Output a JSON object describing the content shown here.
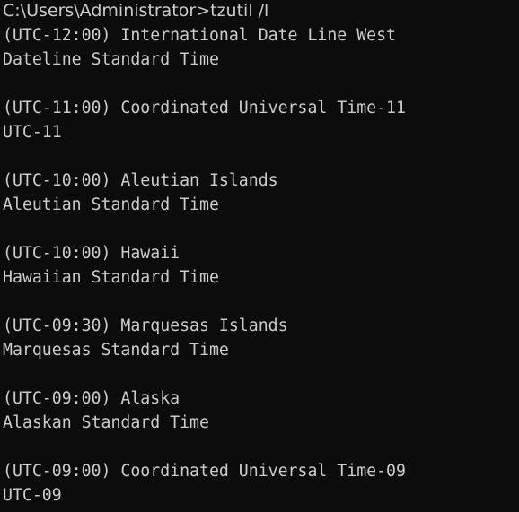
{
  "console": {
    "prompt": "C:\\Users\\Administrator>",
    "command": "tzutil /l",
    "output_lines": [
      "(UTC-12:00) International Date Line West",
      "Dateline Standard Time",
      "",
      "(UTC-11:00) Coordinated Universal Time-11",
      "UTC-11",
      "",
      "(UTC-10:00) Aleutian Islands",
      "Aleutian Standard Time",
      "",
      "(UTC-10:00) Hawaii",
      "Hawaiian Standard Time",
      "",
      "(UTC-09:30) Marquesas Islands",
      "Marquesas Standard Time",
      "",
      "(UTC-09:00) Alaska",
      "Alaskan Standard Time",
      "",
      "(UTC-09:00) Coordinated Universal Time-09",
      "UTC-09"
    ]
  },
  "colors": {
    "background": "#0c0c0c",
    "foreground": "#cccccc"
  }
}
